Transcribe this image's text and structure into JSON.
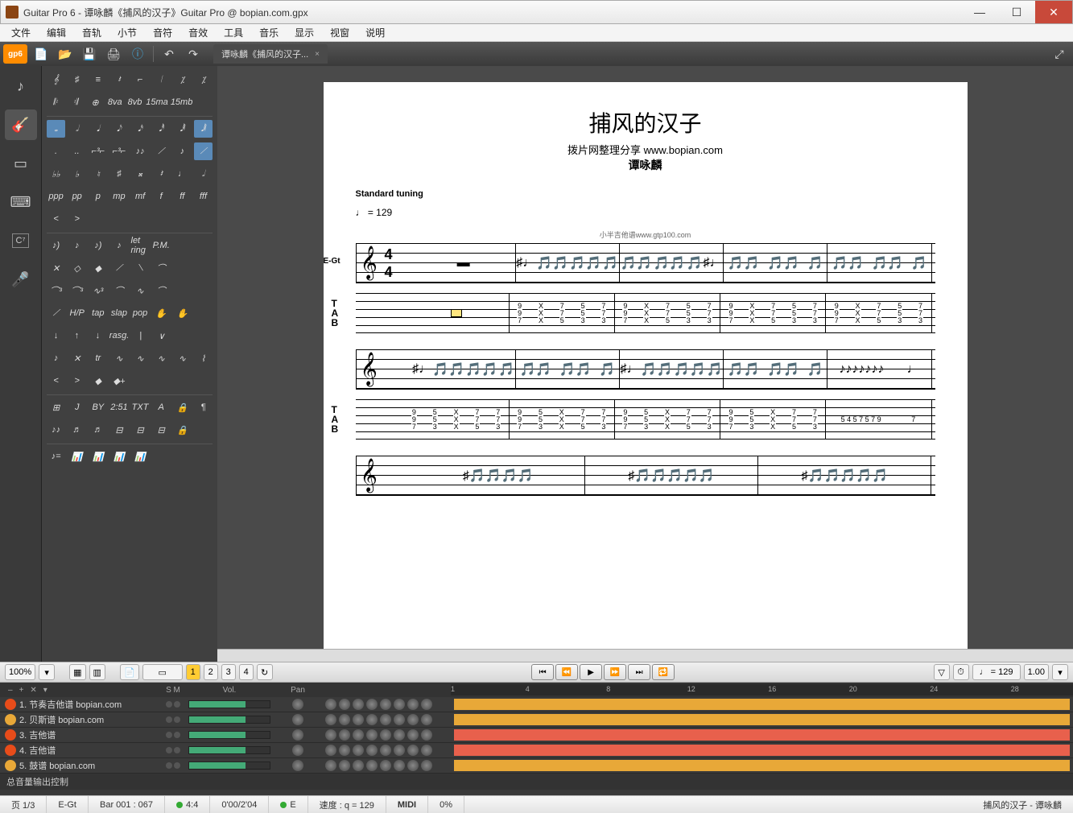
{
  "window": {
    "title": "Guitar Pro 6 - 谭咏麟《捕风的汉子》Guitar Pro @ bopian.com.gpx"
  },
  "menu": [
    "文件",
    "编辑",
    "音轨",
    "小节",
    "音符",
    "音效",
    "工具",
    "音乐",
    "显示",
    "视窗",
    "说明"
  ],
  "doctab": {
    "label": "谭咏麟《捕风的汉子...",
    "close": "×"
  },
  "toolbar": {
    "gp6": "gp6"
  },
  "editpanel": {
    "row_clef": [
      "𝄞",
      "♯",
      "≡",
      "𝄽",
      "⌐",
      "𝄀",
      "⁒",
      "⁒"
    ],
    "row_repeat": [
      "𝄆",
      "𝄇",
      "⊕",
      "8va",
      "8vb",
      "15ma",
      "15mb",
      ""
    ],
    "row_notes": [
      "𝅝",
      "𝅗𝅥",
      "𝅘𝅥",
      "𝅘𝅥𝅮",
      "𝅘𝅥𝅯",
      "𝅘𝅥𝅰",
      "𝅘𝅥𝅱",
      "𝅘𝅥𝅲"
    ],
    "row_dot": [
      ".",
      "..",
      "⌐³⌐",
      "⌐³⌐",
      "♪♪",
      "⟋",
      "♪",
      "⟋"
    ],
    "row_acc": [
      "♭♭",
      "♭",
      "♮",
      "♯",
      "𝄪",
      "𝄽",
      "♩",
      "𝅗𝅥"
    ],
    "row_dyn": [
      "ppp",
      "pp",
      "p",
      "mp",
      "mf",
      "f",
      "ff",
      "fff"
    ],
    "row_cresc": [
      "<",
      ">",
      "",
      "",
      "",
      "",
      "",
      ""
    ],
    "row_grace": [
      "♪)",
      "♪",
      "♪)",
      "♪",
      "let ring",
      "P.M.",
      "",
      ""
    ],
    "row_harm": [
      "✕",
      "◇",
      "◆",
      "⟋",
      "⟍",
      "⌒",
      "",
      ""
    ],
    "row_bend": [
      "⌒³",
      "⌒³",
      "∿³",
      "⌒",
      "∿",
      "⌒",
      "",
      ""
    ],
    "row_tap": [
      "⟋",
      "H/P",
      "tap",
      "slap",
      "pop",
      "✋",
      "✋",
      ""
    ],
    "row_trem": [
      "↓",
      "↑",
      "↓",
      "rasg.",
      "|",
      "∨",
      "",
      ""
    ],
    "row_orn": [
      "♪",
      "✕",
      "tr",
      "∿",
      "∿",
      "∿",
      "∿",
      "⌇"
    ],
    "row_accent": [
      "<",
      ">",
      "◆",
      "◆+",
      "",
      "",
      "",
      ""
    ],
    "row_text": [
      "⊞",
      "J",
      "BY",
      "2:51",
      "TXT",
      "A",
      "🔒",
      "¶"
    ],
    "row_chord": [
      "♪♪",
      "♬",
      "♬",
      "⊟",
      "⊟",
      "⊟",
      "🔒",
      ""
    ],
    "row_auto": [
      "♪=",
      "📊",
      "📊",
      "📊",
      "📊",
      "",
      "",
      ""
    ]
  },
  "score": {
    "title": "捕风的汉子",
    "subtitle": "拨片网整理分享 www.bopian.com",
    "artist": "谭咏麟",
    "tuning": "Standard tuning",
    "tempo": "♩ = 129",
    "credit": "小半吉他谱www.gtp100.com",
    "trackname": "E-Gt",
    "timesig_top": "4",
    "timesig_bot": "4",
    "tab_label_T": "T",
    "tab_label_A": "A",
    "tab_label_B": "B",
    "tab_system1": [
      [
        "",
        "9 9 7",
        "9 9 7",
        "X 7 5",
        "X 7 5",
        "7 7 3",
        "7 7 3"
      ],
      [
        "9 9 7",
        "9 9 7",
        "X 7 5",
        "X 7 5",
        "7 7 3",
        "7 7 3",
        ""
      ]
    ],
    "tab_system2": [
      [
        "9 9 7",
        "5 5 3",
        "X 7 5",
        "X 7 5",
        "7 7 3",
        "9 9 7",
        "5 5 3",
        "X 7 5",
        "X 7 5",
        "7 7 3"
      ],
      [
        "5 4 5 7 5 7 9",
        "7"
      ]
    ]
  },
  "bottombar": {
    "zoom": "100%",
    "pages": [
      "1",
      "2",
      "3",
      "4"
    ],
    "tempo": "♩ = 129",
    "speed": "1.00"
  },
  "tracks": {
    "header": {
      "s": "S",
      "m": "M",
      "vol": "Vol.",
      "pan": "Pan"
    },
    "ruler": [
      "1",
      "4",
      "8",
      "12",
      "16",
      "20",
      "24",
      "28"
    ],
    "list": [
      {
        "icon": "#e84c1a",
        "name": "1. 节奏吉他谱 bopian.com",
        "color": "#e8a838"
      },
      {
        "icon": "#e8a838",
        "name": "2. 贝斯谱 bopian.com",
        "color": "#e8a838"
      },
      {
        "icon": "#e84c1a",
        "name": "3. 吉他谱",
        "color": "#e8604c"
      },
      {
        "icon": "#e84c1a",
        "name": "4. 吉他谱",
        "color": "#e8604c"
      },
      {
        "icon": "#e8a838",
        "name": "5. 鼓谱 bopian.com",
        "color": "#e8a838"
      }
    ],
    "master": "总音量输出控制"
  },
  "status": {
    "page": "页 1/3",
    "track": "E-Gt",
    "bar": "Bar 001 : 067",
    "sig": "4:4",
    "time": "0'00/2'04",
    "key": "E",
    "bpm": "速度 : q = 129",
    "midi": "MIDI",
    "pct": "0%",
    "song": "捕风的汉子 - 谭咏麟"
  }
}
